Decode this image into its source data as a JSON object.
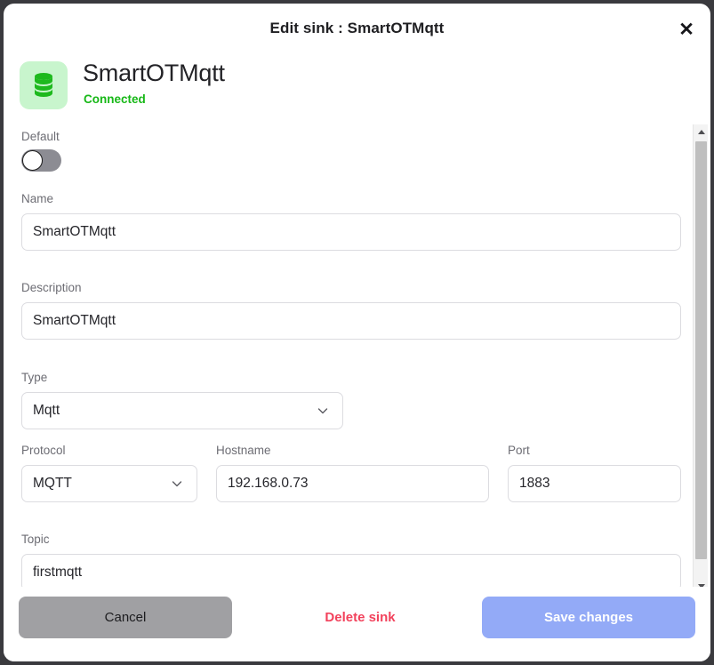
{
  "modal": {
    "title": "Edit sink : SmartOTMqtt",
    "close_icon": "close-icon"
  },
  "sink": {
    "icon": "database-icon",
    "name": "SmartOTMqtt",
    "status": "Connected",
    "status_color": "#17b817",
    "icon_bg": "#c8f5cd",
    "icon_color": "#1db91d"
  },
  "form": {
    "default": {
      "label": "Default",
      "checked": false
    },
    "name": {
      "label": "Name",
      "value": "SmartOTMqtt",
      "placeholder": "Name"
    },
    "description": {
      "label": "Description",
      "value": "SmartOTMqtt",
      "placeholder": "Description"
    },
    "type": {
      "label": "Type",
      "value": "Mqtt",
      "icon": "chevron-down-icon"
    },
    "protocol": {
      "label": "Protocol",
      "value": "MQTT",
      "icon": "chevron-down-icon"
    },
    "hostname": {
      "label": "Hostname",
      "value": "192.168.0.73",
      "placeholder": "Hostname"
    },
    "port": {
      "label": "Port",
      "value": "1883",
      "placeholder": "Port"
    },
    "topic": {
      "label": "Topic",
      "value": "firstmqtt",
      "placeholder": "Topic"
    }
  },
  "footer": {
    "cancel": "Cancel",
    "delete": "Delete sink",
    "save": "Save changes",
    "cancel_color": "#a0a0a3",
    "delete_color": "#f2425c",
    "save_color": "#93aaf7"
  },
  "scrollbar": {
    "up_icon": "scroll-up-arrow-icon",
    "down_icon": "scroll-down-arrow-icon"
  }
}
